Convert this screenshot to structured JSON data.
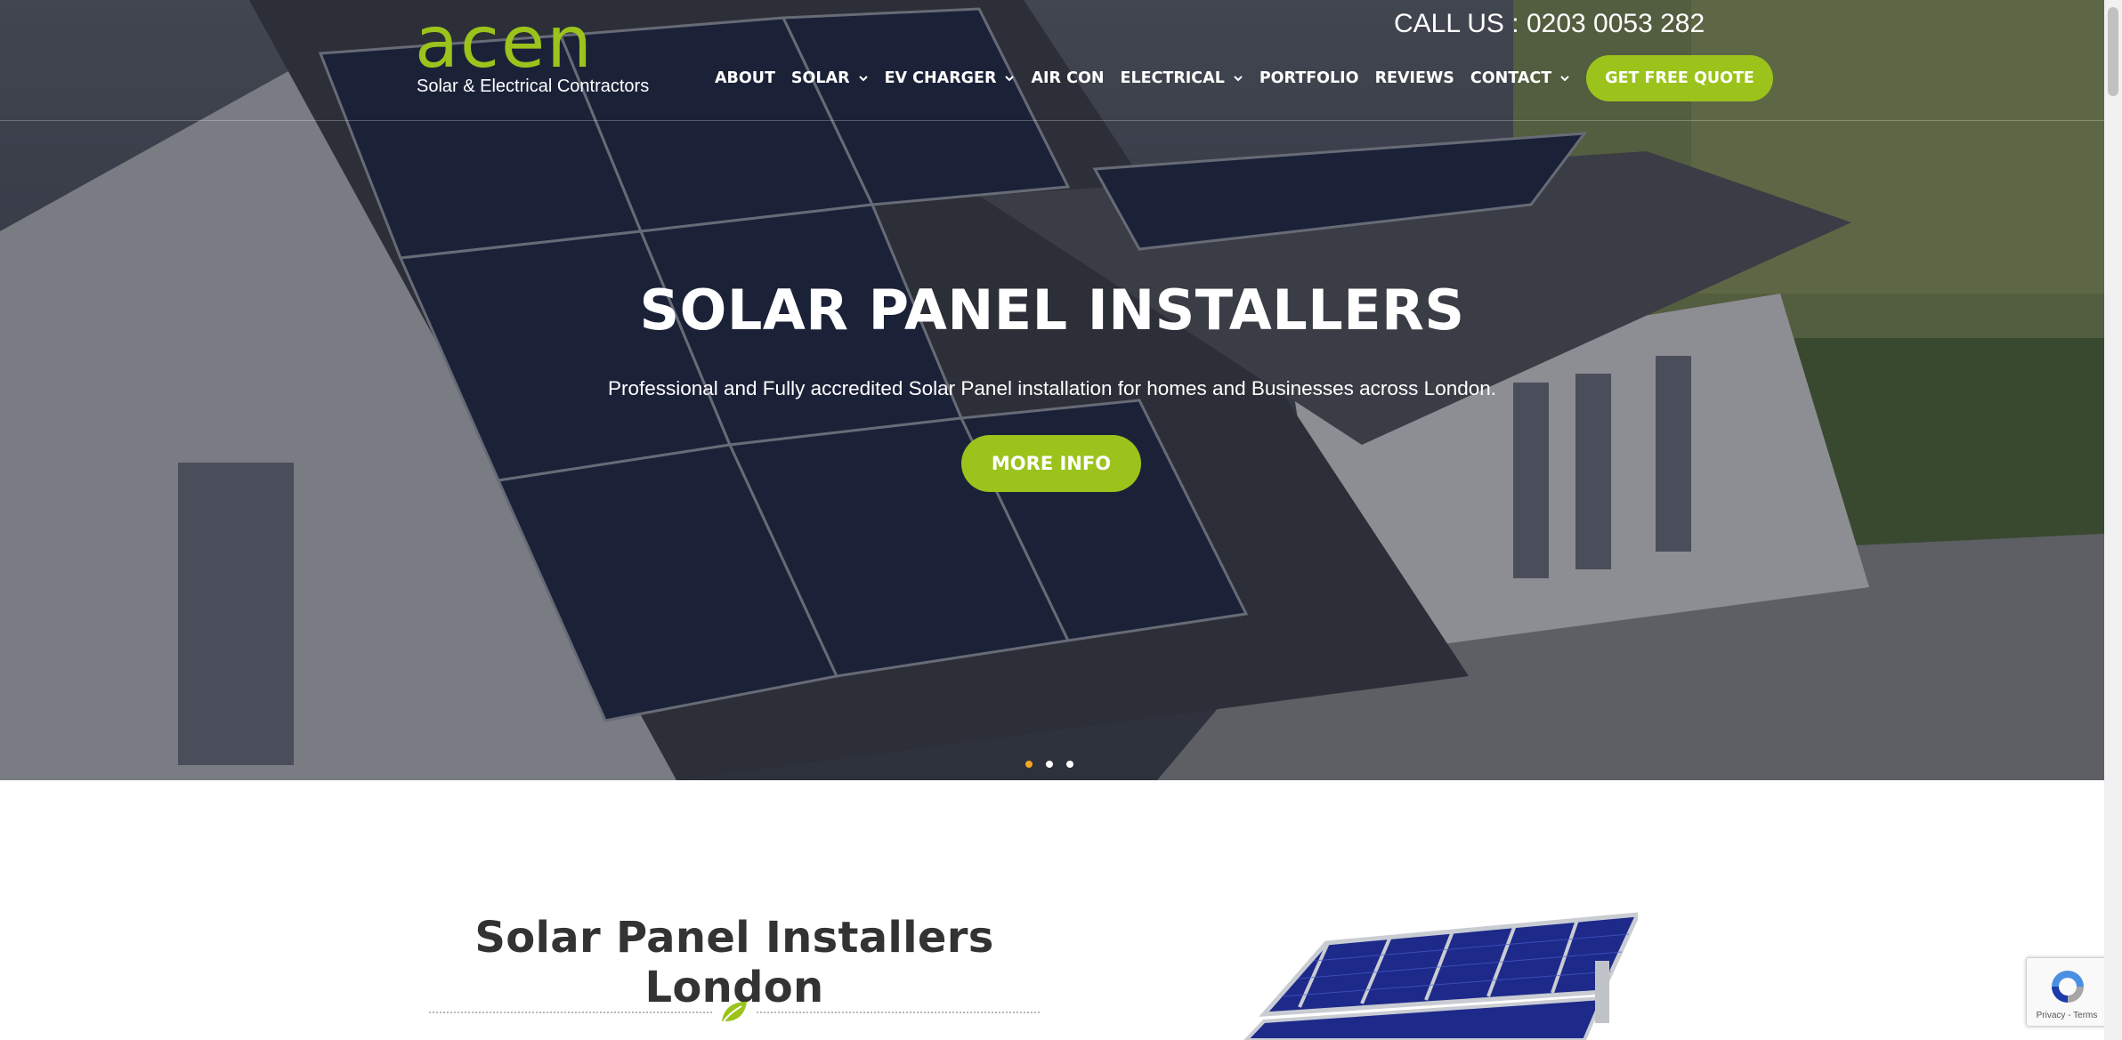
{
  "header": {
    "logo_word": "acen",
    "logo_tagline": "Solar & Electrical Contractors",
    "call_us": "CALL US : 0203 0053 282",
    "nav": [
      {
        "label": "ABOUT",
        "has_dropdown": false
      },
      {
        "label": "SOLAR",
        "has_dropdown": true
      },
      {
        "label": "EV CHARGER",
        "has_dropdown": true
      },
      {
        "label": "AIR CON",
        "has_dropdown": false
      },
      {
        "label": "ELECTRICAL",
        "has_dropdown": true
      },
      {
        "label": "PORTFOLIO",
        "has_dropdown": false
      },
      {
        "label": "REVIEWS",
        "has_dropdown": false
      },
      {
        "label": "CONTACT",
        "has_dropdown": true
      }
    ],
    "cta_label": "GET FREE QUOTE"
  },
  "hero": {
    "title": "SOLAR PANEL INSTALLERS",
    "subtitle": "Professional and Fully accredited Solar Panel installation for homes and Businesses across London.",
    "button_label": "MORE INFO",
    "slides": 3,
    "active_slide": 1
  },
  "section": {
    "title": "Solar Panel Installers London",
    "divider_icon": "leaf-icon"
  },
  "recaptcha": {
    "text": "Privacy - Terms"
  },
  "colors": {
    "accent": "#9bc31c",
    "active_dot": "#f5a623",
    "heading": "#333333"
  }
}
